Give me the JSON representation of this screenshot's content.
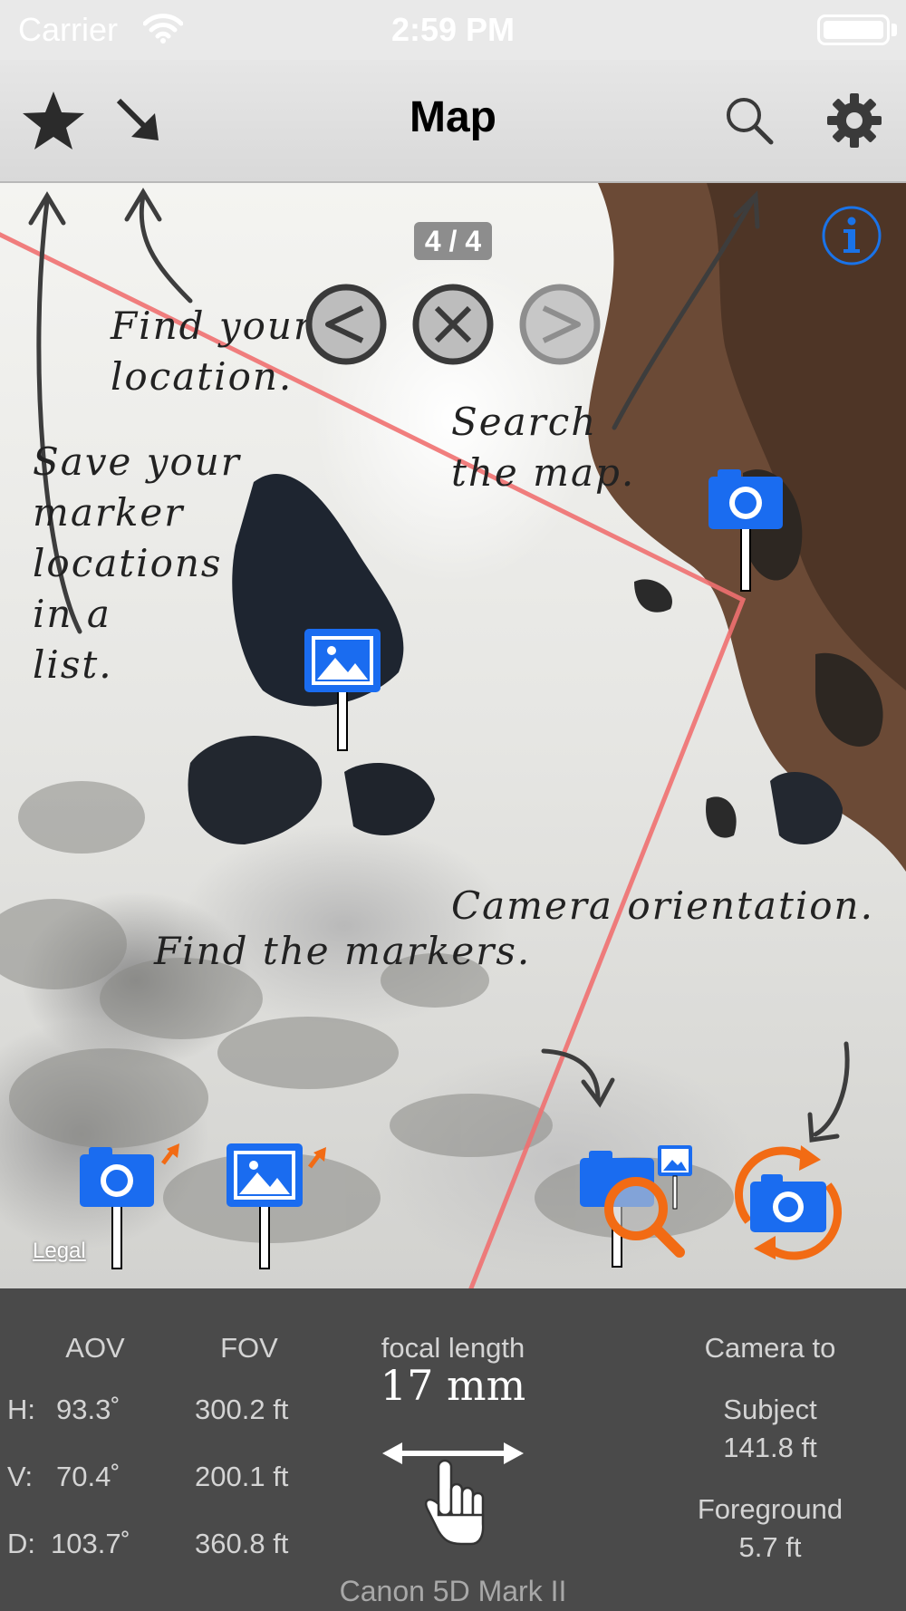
{
  "status_bar": {
    "carrier": "Carrier",
    "time": "2:59 PM"
  },
  "nav": {
    "title": "Map",
    "left_icons": [
      "star-icon",
      "location-arrow-icon"
    ],
    "right_icons": [
      "search-icon",
      "gear-icon"
    ]
  },
  "map": {
    "counter": "4 / 4",
    "legal": "Legal",
    "annotations": {
      "find_location": "Find your\nlocation.",
      "save_markers": "Save your\nmarker\nlocations\nin a\nlist.",
      "search_map": "Search\nthe map.",
      "camera_orientation": "Camera orientation.",
      "find_markers": "Find the markers."
    },
    "colors": {
      "route_line": "#f07070",
      "marker_blue": "#1a6cf0",
      "accent_orange": "#f26b14"
    }
  },
  "panel": {
    "headers": {
      "aov": "AOV",
      "fov": "FOV",
      "focal": "focal length",
      "camera_to": "Camera to"
    },
    "rows": [
      {
        "label": "H:",
        "aov": "93.3˚",
        "fov": "300.2 ft"
      },
      {
        "label": "V:",
        "aov": "70.4˚",
        "fov": "200.1 ft"
      },
      {
        "label": "D:",
        "aov": "103.7˚",
        "fov": "360.8 ft"
      }
    ],
    "focal_length": "17 mm",
    "subject": {
      "label": "Subject",
      "value": "141.8 ft"
    },
    "foreground": {
      "label": "Foreground",
      "value": "5.7 ft"
    },
    "camera_model": "Canon 5D Mark II"
  }
}
